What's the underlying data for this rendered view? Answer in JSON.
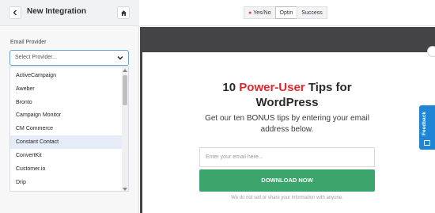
{
  "sidebar": {
    "title": "New Integration",
    "field_label": "Email Provider",
    "select_placeholder": "Select Provider...",
    "providers": [
      "ActiveCampaign",
      "Aweber",
      "Bronto",
      "Campaign Monitor",
      "CM Commerce",
      "Constant Contact",
      "ConvertKit",
      "Customer.io",
      "Drip"
    ],
    "highlighted_provider": "Constant Contact"
  },
  "tabs": [
    {
      "label": "Yes/No",
      "dot": "●"
    },
    {
      "label": "Optin"
    },
    {
      "label": "Success"
    }
  ],
  "active_tab": "Optin",
  "popup": {
    "headline_pre": "10 ",
    "headline_red": "Power-User",
    "headline_post": " Tips for WordPress",
    "subtext": "Get our ten BONUS tips by entering your email address below.",
    "email_placeholder": "Enter your email here...",
    "button_label": "DOWNLOAD NOW",
    "disclaimer": "We do not sell or share your information with anyone."
  },
  "feedback_label": "Feedback",
  "colors": {
    "accent_red": "#e3272b",
    "button_green": "#3ba56c",
    "feedback_blue": "#1f86d6",
    "canvas_dark": "#444446"
  },
  "icons": [
    "chevron-left-icon",
    "home-icon",
    "chevron-down-icon",
    "feedback-icon"
  ]
}
